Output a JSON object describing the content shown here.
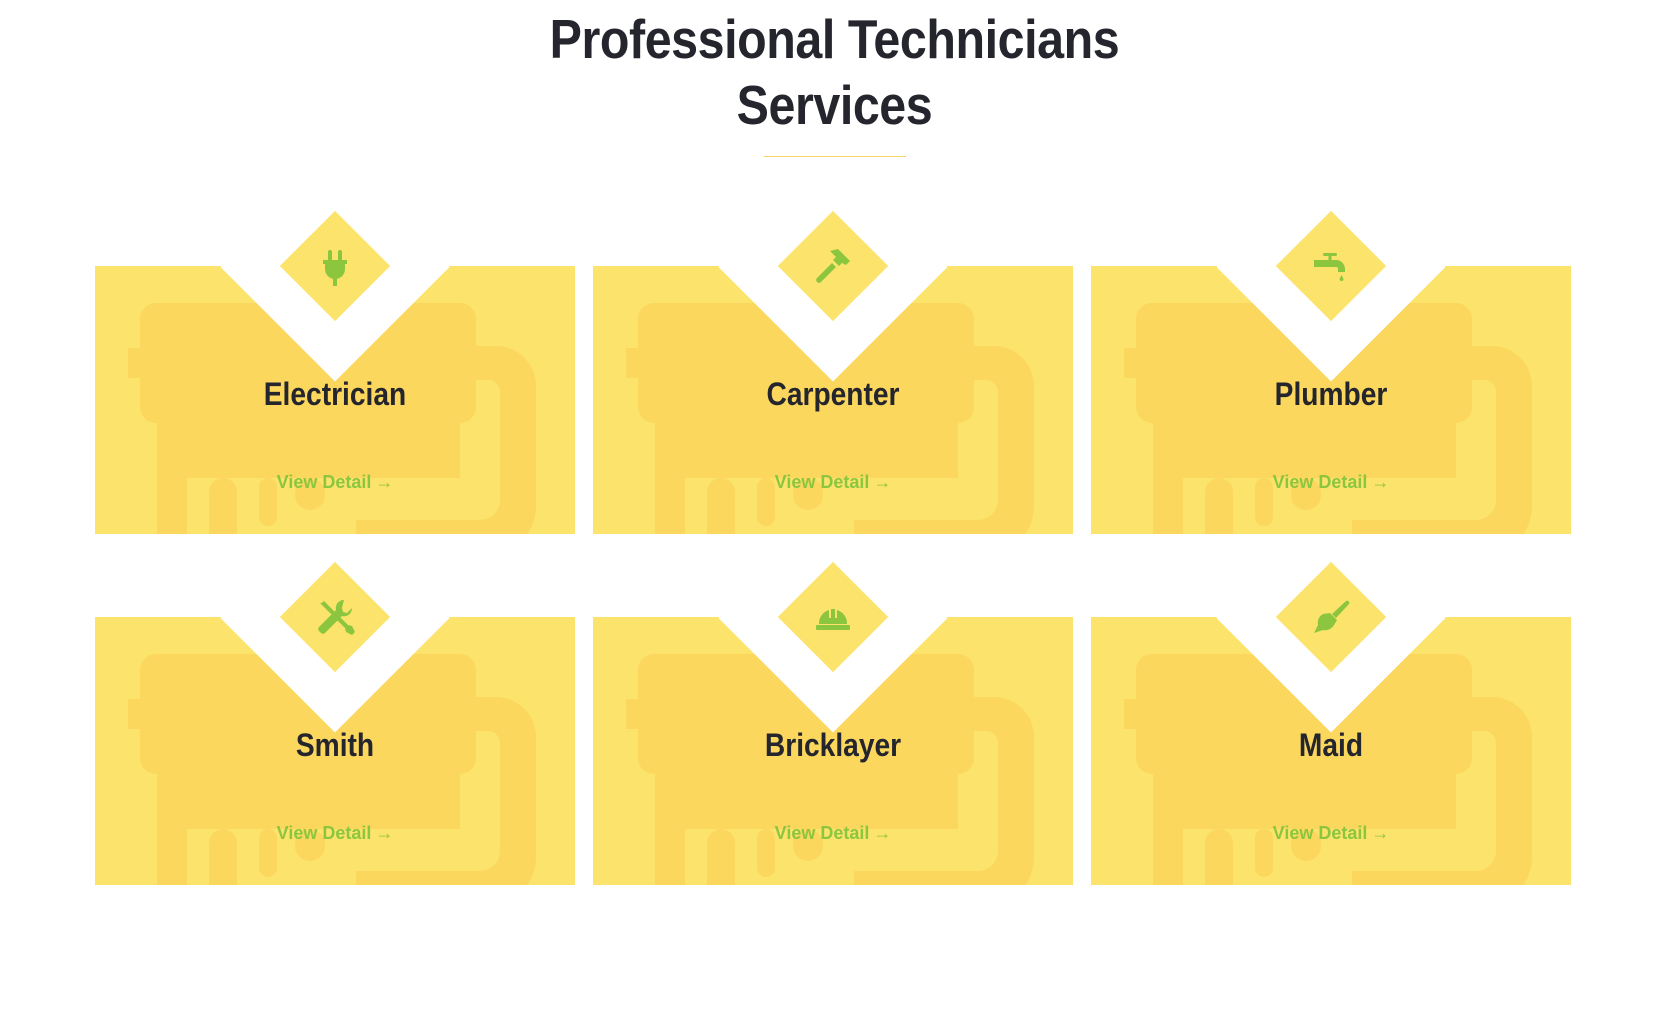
{
  "section": {
    "title_line1": "Professional Technicians",
    "title_line2": "Services"
  },
  "colors": {
    "card_background": "#fce36c",
    "card_watermark": "#fbd75d",
    "icon_color": "#8cc63f",
    "title_color": "#24252d",
    "link_color": "#8cc63f"
  },
  "services": [
    {
      "name": "Electrician",
      "link_label": "View Detail",
      "arrow": "→",
      "icon": "plug-icon"
    },
    {
      "name": "Carpenter",
      "link_label": "View Detail",
      "arrow": "→",
      "icon": "hammer-icon"
    },
    {
      "name": "Plumber",
      "link_label": "View Detail",
      "arrow": "→",
      "icon": "faucet-icon"
    },
    {
      "name": "Smith",
      "link_label": "View Detail",
      "arrow": "→",
      "icon": "tools-icon"
    },
    {
      "name": "Bricklayer",
      "link_label": "View Detail",
      "arrow": "→",
      "icon": "hard-hat-icon"
    },
    {
      "name": "Maid",
      "link_label": "View Detail",
      "arrow": "→",
      "icon": "brush-icon"
    }
  ]
}
